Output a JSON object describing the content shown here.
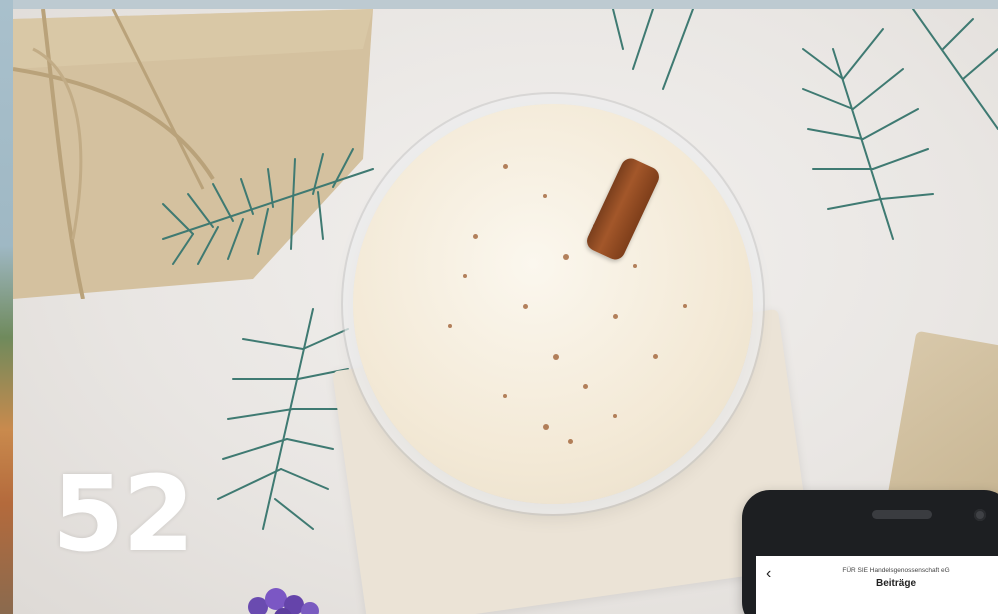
{
  "page": {
    "number": "52"
  },
  "phone": {
    "header": {
      "back_icon": "chevron-left-icon",
      "organization": "FÜR SIE Handelsgenossenschaft eG",
      "title": "Beiträge"
    }
  },
  "colors": {
    "page_number": "#ffffff",
    "cinnamon": "#8a4a22",
    "phone_body": "#1d1f22",
    "eggnog": "#f3e9d6"
  }
}
